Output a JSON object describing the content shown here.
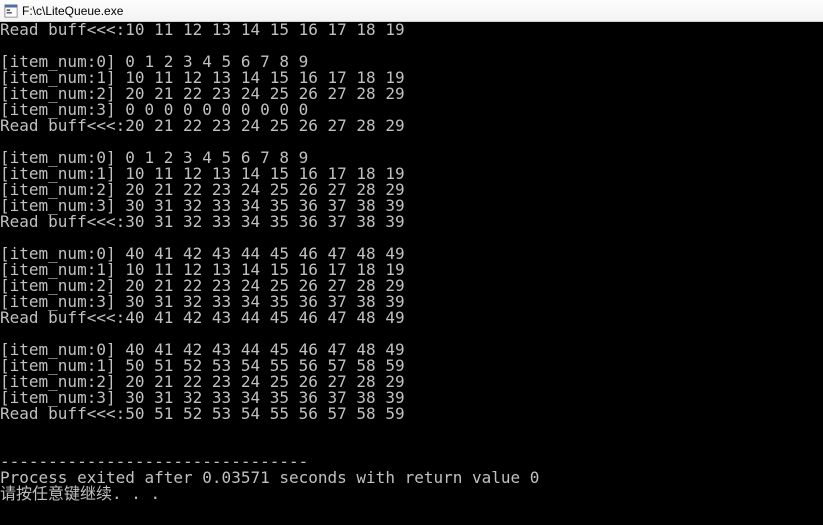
{
  "window": {
    "title": "F:\\c\\LiteQueue.exe"
  },
  "console": {
    "lines": [
      "Read buff<<<:10 11 12 13 14 15 16 17 18 19",
      "",
      "[item_num:0] 0 1 2 3 4 5 6 7 8 9",
      "[item_num:1] 10 11 12 13 14 15 16 17 18 19",
      "[item_num:2] 20 21 22 23 24 25 26 27 28 29",
      "[item_num:3] 0 0 0 0 0 0 0 0 0 0",
      "Read buff<<<:20 21 22 23 24 25 26 27 28 29",
      "",
      "[item_num:0] 0 1 2 3 4 5 6 7 8 9",
      "[item_num:1] 10 11 12 13 14 15 16 17 18 19",
      "[item_num:2] 20 21 22 23 24 25 26 27 28 29",
      "[item_num:3] 30 31 32 33 34 35 36 37 38 39",
      "Read buff<<<:30 31 32 33 34 35 36 37 38 39",
      "",
      "[item_num:0] 40 41 42 43 44 45 46 47 48 49",
      "[item_num:1] 10 11 12 13 14 15 16 17 18 19",
      "[item_num:2] 20 21 22 23 24 25 26 27 28 29",
      "[item_num:3] 30 31 32 33 34 35 36 37 38 39",
      "Read buff<<<:40 41 42 43 44 45 46 47 48 49",
      "",
      "[item_num:0] 40 41 42 43 44 45 46 47 48 49",
      "[item_num:1] 50 51 52 53 54 55 56 57 58 59",
      "[item_num:2] 20 21 22 23 24 25 26 27 28 29",
      "[item_num:3] 30 31 32 33 34 35 36 37 38 39",
      "Read buff<<<:50 51 52 53 54 55 56 57 58 59",
      "",
      "",
      "--------------------------------",
      "Process exited after 0.03571 seconds with return value 0",
      "请按任意键继续. . ."
    ]
  }
}
